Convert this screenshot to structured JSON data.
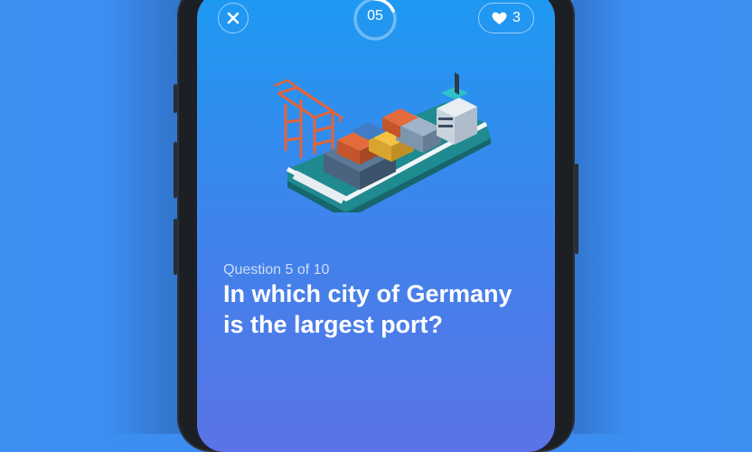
{
  "header": {
    "close_icon": "close-icon",
    "timer_value": "05",
    "lives_icon": "heart-icon",
    "lives_count": "3"
  },
  "illustration": {
    "subject": "cargo-ship-with-containers-and-port-crane"
  },
  "question": {
    "counter": "Question 5 of 10",
    "text": "In which city of Germany is the largest port?"
  },
  "colors": {
    "background": "#3a8bef",
    "screen_top": "#1d9af2",
    "screen_bottom": "#5a73e6",
    "text": "#ffffff"
  }
}
